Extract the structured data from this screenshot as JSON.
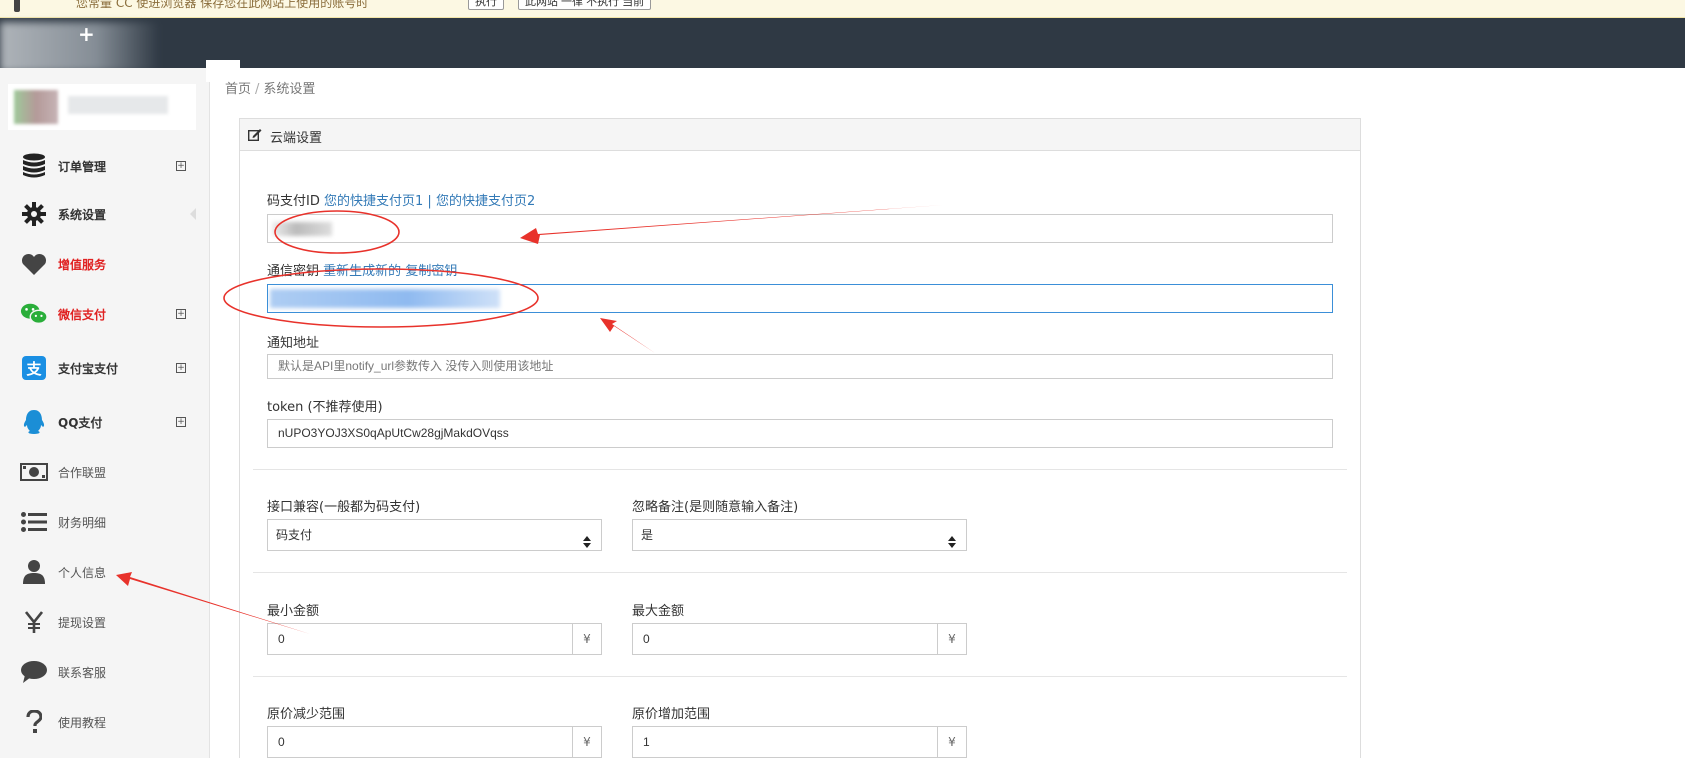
{
  "notify": {
    "text": "您常量 CC 使进浏览器 保存您在此网站上使用的账号时",
    "btn1": "执行",
    "btn2": "此网站 一律 不执行 当前"
  },
  "sidebar": {
    "items": [
      {
        "label": "订单管理",
        "icon": "database-icon",
        "style": "bold",
        "expand": "+"
      },
      {
        "label": "系统设置",
        "icon": "gear-icon",
        "style": "bold"
      },
      {
        "label": "增值服务",
        "icon": "heart-icon",
        "style": "red"
      },
      {
        "label": "微信支付",
        "icon": "wechat-icon",
        "style": "red",
        "expand": "+"
      },
      {
        "label": "支付宝支付",
        "icon": "alipay-icon",
        "style": "bold",
        "expand": "+"
      },
      {
        "label": "QQ支付",
        "icon": "qq-icon",
        "style": "bold",
        "expand": "+"
      },
      {
        "label": "合作联盟",
        "icon": "money-icon",
        "style": "gray"
      },
      {
        "label": "财务明细",
        "icon": "list-icon",
        "style": "gray"
      },
      {
        "label": "个人信息",
        "icon": "user-icon",
        "style": "gray"
      },
      {
        "label": "提现设置",
        "icon": "yen-icon",
        "style": "gray"
      },
      {
        "label": "联系客服",
        "icon": "chat-icon",
        "style": "gray"
      },
      {
        "label": "使用教程",
        "icon": "question-icon",
        "style": "gray"
      }
    ]
  },
  "breadcrumb": {
    "home": "首页",
    "sep": "/",
    "current": "系统设置"
  },
  "panel": {
    "title": "云端设置",
    "code_pay_id": {
      "label": "码支付ID",
      "link1": "您的快捷支付页1",
      "sep": "|",
      "link2": "您的快捷支付页2"
    },
    "secret": {
      "label": "通信密钥",
      "link1": "重新生成新的",
      "link2": "复制密钥"
    },
    "notify_url": {
      "label": "通知地址",
      "placeholder": "默认是API里notify_url参数传入 没传入则使用该地址"
    },
    "token": {
      "label": "token (不推荐使用)",
      "value": "nUPO3YOJ3XS0qApUtCw28gjMakdOVqss"
    },
    "compat": {
      "label": "接口兼容(一般都为码支付)",
      "value": "码支付"
    },
    "ignore_note": {
      "label": "忽略备注(是则随意输入备注)",
      "value": "是"
    },
    "min_amount": {
      "label": "最小金额",
      "value": "0",
      "unit": "¥"
    },
    "max_amount": {
      "label": "最大金额",
      "value": "0",
      "unit": "¥"
    },
    "decrease": {
      "label": "原价减少范围",
      "value": "0",
      "unit": "¥"
    },
    "increase": {
      "label": "原价增加范围",
      "value": "1",
      "unit": "¥"
    }
  },
  "colors": {
    "header": "#2f3944",
    "sidebar": "#f5f5f5",
    "link": "#337ab7",
    "red": "#e02222",
    "annotation": "#e8322b"
  }
}
